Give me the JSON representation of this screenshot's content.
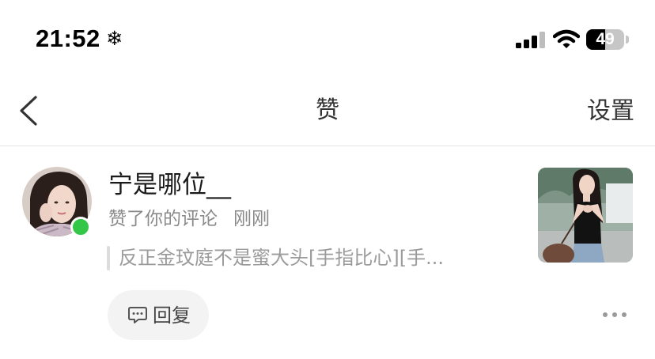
{
  "status_bar": {
    "time": "21:52",
    "weather_icon": "snowflake-icon",
    "signal_bars_active": 3,
    "signal_bars_total": 4,
    "wifi_icon": "wifi-icon",
    "battery_percent": 49,
    "battery_label": "49"
  },
  "nav_bar": {
    "back_icon": "chevron-left-icon",
    "title": "赞",
    "settings_label": "设置"
  },
  "notifications": [
    {
      "username": "宁是哪位__",
      "online": true,
      "action_text": "赞了你的评论",
      "time_text": "刚刚",
      "comment_preview": "反正金玟庭不是蜜大头[手指比心][手...",
      "reply_icon": "comment-icon",
      "reply_label": "回复",
      "more_icon": "more-dots-icon"
    }
  ],
  "colors": {
    "online_dot": "#34c646",
    "signal_active": "#000000",
    "signal_inactive": "#bdbdbd",
    "text_primary": "#1a1a1a",
    "text_secondary": "#8a8a8a",
    "divider": "#e6e6e6",
    "pill_background": "#f3f3f3"
  }
}
